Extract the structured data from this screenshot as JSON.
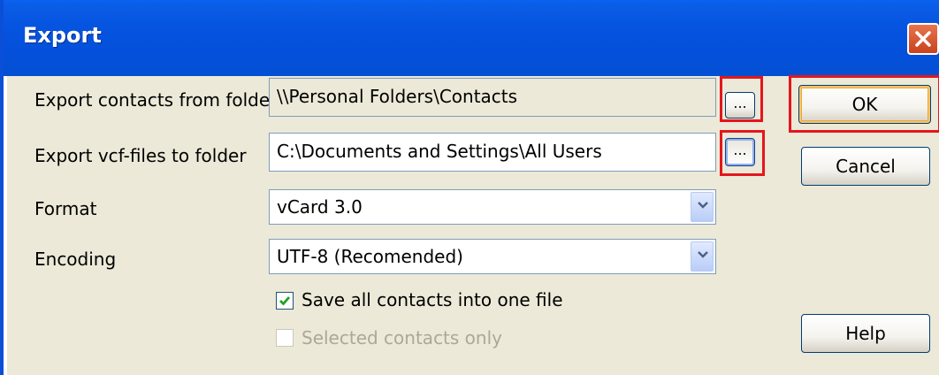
{
  "window": {
    "title": "Export",
    "close_icon": "close-icon",
    "accent": "#0553df"
  },
  "form": {
    "export_from": {
      "label": "Export contacts from folder",
      "value": "\\\\Personal Folders\\Contacts",
      "browse_label": "..."
    },
    "export_to": {
      "label": "Export vcf-files to folder",
      "value": "C:\\Documents and Settings\\All Users",
      "browse_label": "..."
    },
    "format": {
      "label": "Format",
      "value": "vCard 3.0",
      "arrow_icon": "chevron-down-icon"
    },
    "encoding": {
      "label": "Encoding",
      "value": "UTF-8 (Recomended)",
      "arrow_icon": "chevron-down-icon"
    },
    "save_one_file": {
      "label": "Save all contacts into one file",
      "checked": true
    },
    "selected_only": {
      "label": "Selected contacts only",
      "checked": false,
      "enabled": false
    }
  },
  "buttons": {
    "ok": "OK",
    "cancel": "Cancel",
    "help": "Help"
  },
  "highlight_color": "#e4161d"
}
